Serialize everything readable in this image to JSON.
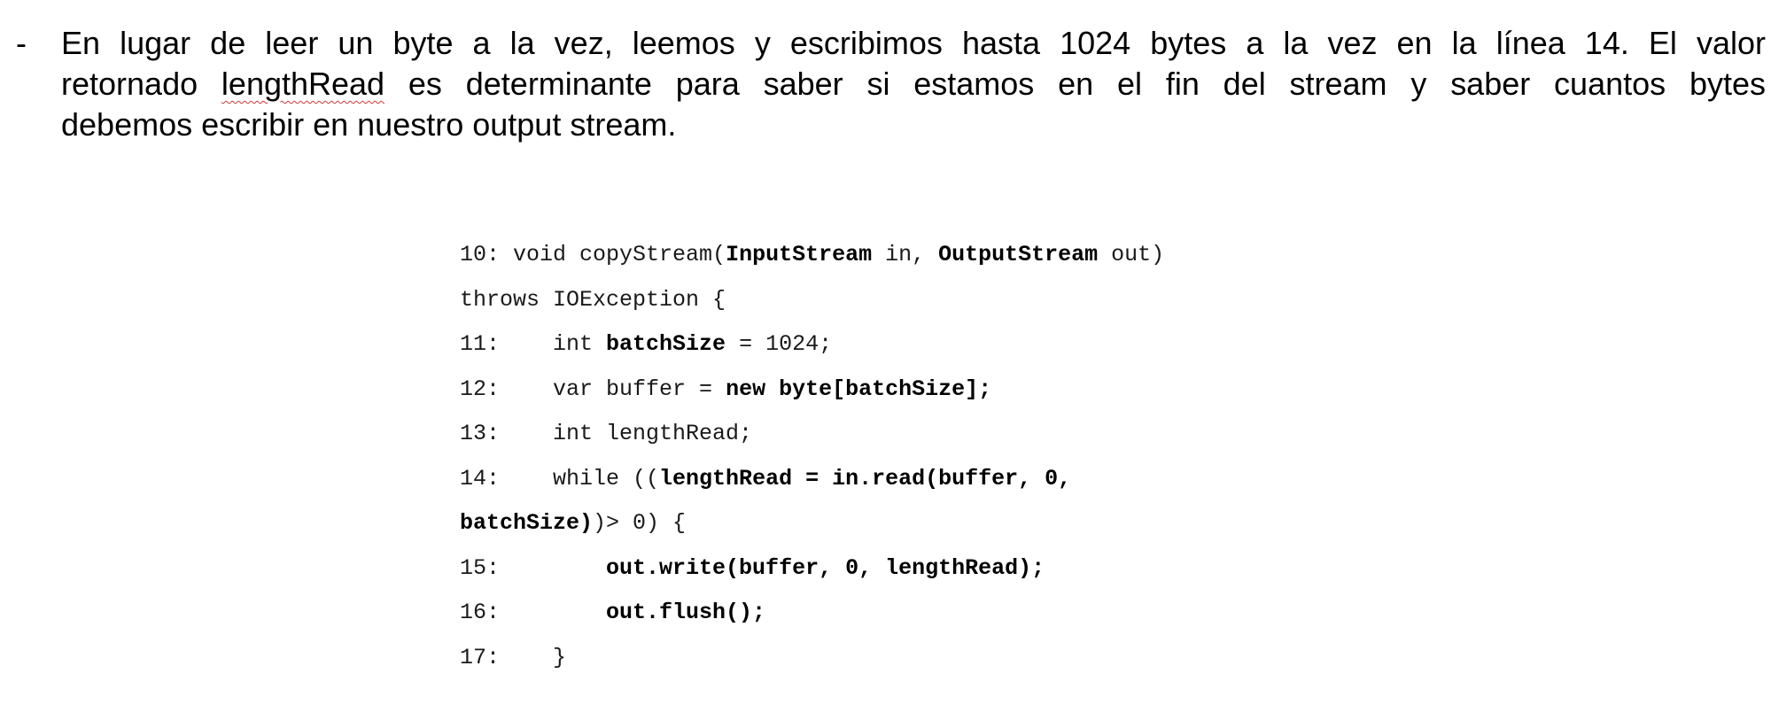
{
  "paragraph": {
    "bullet": "-",
    "line1": "En lugar de leer un byte a la vez, leemos y escribimos hasta 1024 bytes a la vez en la línea 14. El valor",
    "line2_pre": "retornado ",
    "line2_term": "lengthRead",
    "line2_post": " es determinante para saber si estamos en el fin del stream y saber cuantos bytes",
    "line3": "debemos escribir en nuestro output stream."
  },
  "code": {
    "l10": {
      "a": "10: void copyStream(",
      "b": "InputStream",
      "c": " in, ",
      "d": "OutputStream",
      "e": " out)"
    },
    "l10b": {
      "a": "throws IOException {"
    },
    "l11": {
      "a": "11:    int ",
      "b": "batchSize",
      "c": " = 1024;"
    },
    "l12": {
      "a": "12:    var buffer = ",
      "b": "new byte[batchSize];"
    },
    "l13": {
      "a": "13:    int lengthRead;"
    },
    "l14": {
      "a": "14:    while ((",
      "b": "lengthRead = in.read(buffer, 0,"
    },
    "l14b": {
      "a": "batchSize)",
      "b": ")> 0) {"
    },
    "l15": {
      "a": "15:        ",
      "b": "out.write(buffer, 0, lengthRead);"
    },
    "l16": {
      "a": "16:        ",
      "b": "out.flush();"
    },
    "l17": {
      "a": "17:    }"
    }
  }
}
